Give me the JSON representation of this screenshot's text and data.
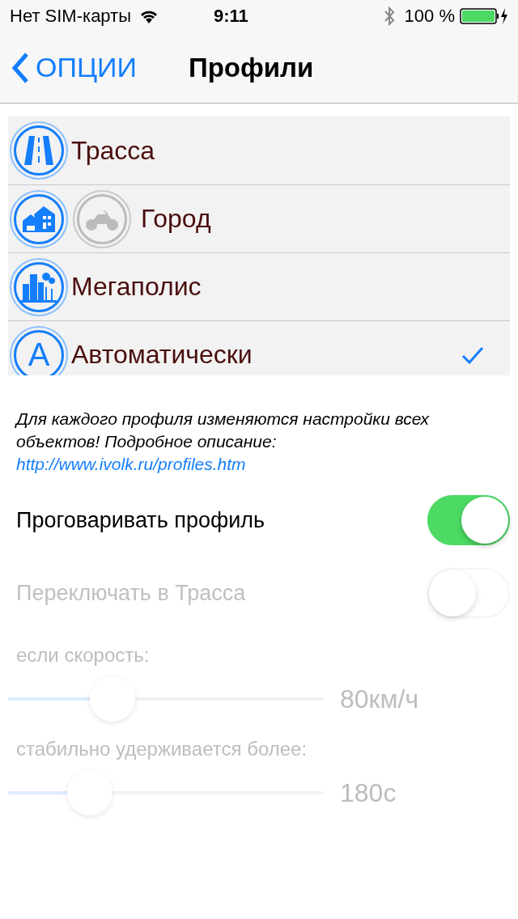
{
  "status_bar": {
    "carrier": "Нет SIM-карты",
    "time": "9:11",
    "battery": "100 %"
  },
  "nav": {
    "back": "ОПЦИИ",
    "title": "Профили"
  },
  "profiles": [
    {
      "kind": "road",
      "label": "Трасса",
      "selected": false
    },
    {
      "kind": "town",
      "label": "Город",
      "selected": false
    },
    {
      "kind": "city",
      "label": "Мегаполис",
      "selected": false
    },
    {
      "kind": "auto",
      "badge": "A",
      "label": "Автоматически",
      "selected": true
    }
  ],
  "note": {
    "text": "Для каждого профиля изменяются настройки всех объектов! Подробное описание:",
    "link": "http://www.ivolk.ru/profiles.htm"
  },
  "switches": [
    {
      "label": "Проговаривать профиль",
      "on": true,
      "disabled": false
    },
    {
      "label": "Переключать в Трасса",
      "on": false,
      "disabled": true
    }
  ],
  "sliders": [
    {
      "label": "если скорость:",
      "level": 0.33,
      "reading": "80км/ч",
      "disabled": true
    },
    {
      "label": "стабильно удерживается более:",
      "level": 0.26,
      "reading": "180с",
      "disabled": true
    }
  ]
}
